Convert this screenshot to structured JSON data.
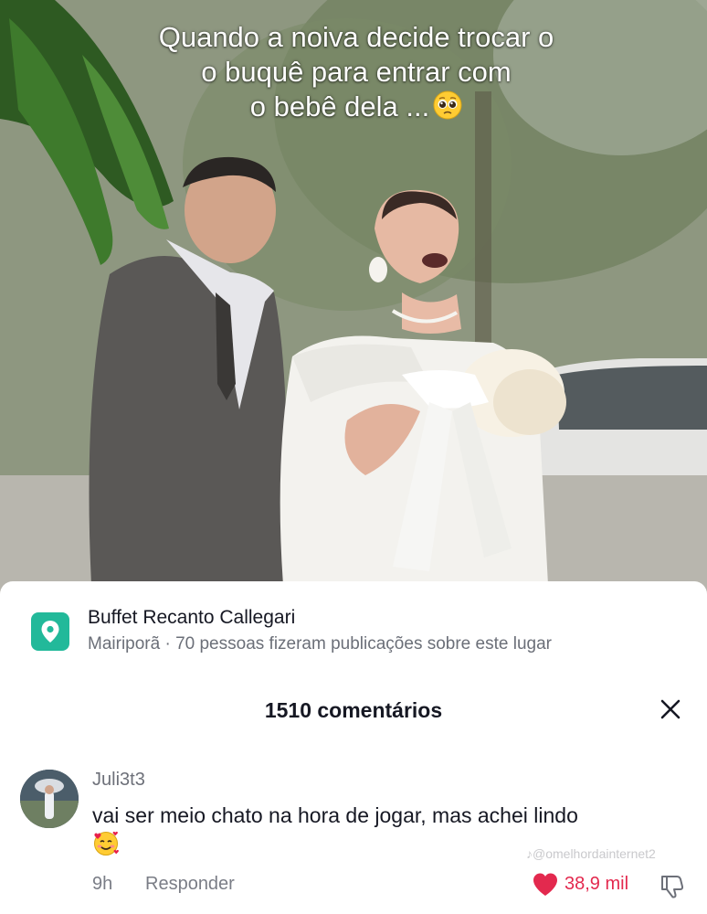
{
  "video": {
    "caption_lines": [
      "Quando a noiva decide trocar o",
      "o buquê para entrar com",
      "o bebê dela ..."
    ],
    "caption_emoji": "pleading-face"
  },
  "location": {
    "icon": "location-pin-icon",
    "accent_color": "#22b99a",
    "name": "Buffet Recanto Callegari",
    "subtitle": "Mairiporã · 70 pessoas fizeram publicações sobre este lugar"
  },
  "comments": {
    "count_label": "1510 comentários",
    "close_icon": "close-icon",
    "items": [
      {
        "username": "Juli3t3",
        "text": "vai ser meio chato na hora de jogar, mas achei lindo",
        "emoji": "smiling-face-with-hearts",
        "time": "9h",
        "reply_label": "Responder",
        "likes": "38,9 mil",
        "like_color": "#e3294e",
        "watermark": "♪@omelhordainternet2"
      }
    ]
  }
}
